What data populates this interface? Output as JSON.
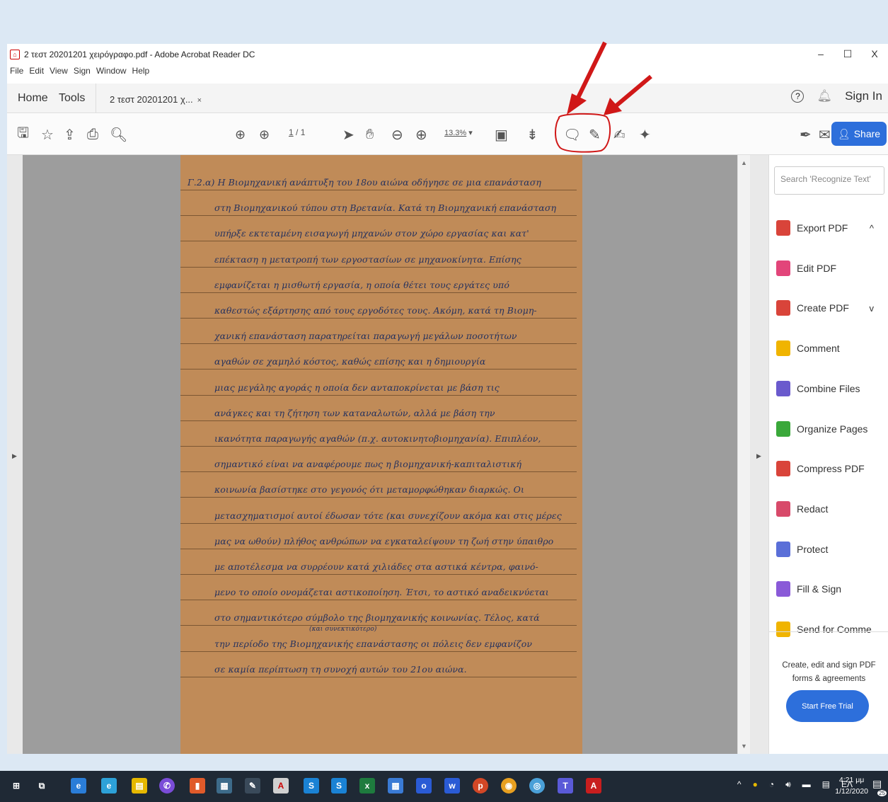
{
  "window": {
    "title": "2 τεστ 20201201 χειρόγραφο.pdf - Adobe Acrobat Reader DC",
    "controls": [
      "–",
      "☐",
      "X"
    ]
  },
  "menu": [
    "File",
    "Edit",
    "View",
    "Sign",
    "Window",
    "Help"
  ],
  "tabs": {
    "home": "Home",
    "tools": "Tools",
    "doc": "2 τεστ 20201201 χ...",
    "close": "×",
    "help": "?",
    "sign_in": "Sign In"
  },
  "toolbar": {
    "page_current": "1",
    "page_total": "/ 1",
    "zoom": "13.3%",
    "share": "Share"
  },
  "document": {
    "lines": [
      "Γ.2.α) Η Βιομηχανική ανάπτυξη του 18ου αιώνα οδήγησε σε μια επανάσταση",
      "στη Βιομηχανικού τύπου στη Βρετανία. Κατά τη Βιομηχανική επανάσταση",
      "υπήρξε εκτεταμένη εισαγωγή μηχανών στον χώρο εργασίας και κατ'",
      "επέκταση η μετατροπή των εργοστασίων σε μηχανοκίνητα. Επίσης",
      "εμφανίζεται η μισθωτή εργασία, η οποία θέτει τους εργάτες υπό",
      "καθεστώς εξάρτησης από τους εργοδότες τους. Ακόμη, κατά τη Βιομη-",
      "χανική επανάσταση παρατηρείται παραγωγή μεγάλων ποσοτήτων",
      "αγαθών σε χαμηλό κόστος, καθώς επίσης και η δημιουργία",
      "μιας μεγάλης αγοράς η οποία δεν ανταποκρίνεται με βάση τις",
      "ανάγκες και τη ζήτηση των καταναλωτών, αλλά με βάση την",
      "ικανότητα παραγωγής αγαθών (π.χ. αυτοκινητοβιομηχανία). Επιπλέον,",
      "σημαντικό είναι να αναφέρουμε πως η βιομηχανική-καπιταλιστική",
      "κοινωνία βασίστηκε στο γεγονός ότι μεταμορφώθηκαν διαρκώς. Οι",
      "μετασχηματισμοί αυτοί έδωσαν τότε (και συνεχίζουν ακόμα και στις μέρες",
      "μας να ωθούν) πλήθος ανθρώπων να εγκαταλείψουν τη ζωή στην ύπαιθρο",
      "με αποτέλεσμα να συρρέουν κατά χιλιάδες στα αστικά κέντρα, φαινό-",
      "μενο το οποίο ονομάζεται αστικοποίηση. Έτσι, το αστικό αναδεικνύεται",
      "στο σημαντικότερο σύμβολο της βιομηχανικής κοινωνίας. Τέλος, κατά",
      "την περίοδο της Βιομηχανικής επανάστασης οι πόλεις δεν εμφανίζον",
      "σε καμία περίπτωση τη συνοχή αυτών του 21ου αιώνα."
    ],
    "annotation": "(και συνεκτικότερο)"
  },
  "search": {
    "placeholder": "Search 'Recognize Text'"
  },
  "right_panel": [
    {
      "label": "Export PDF",
      "icon": "export-pdf-icon",
      "color": "#d9443a",
      "chevron": "^"
    },
    {
      "label": "Edit PDF",
      "icon": "edit-pdf-icon",
      "color": "#e2457a",
      "chevron": ""
    },
    {
      "label": "Create PDF",
      "icon": "create-pdf-icon",
      "color": "#d9443a",
      "chevron": "v"
    },
    {
      "label": "Comment",
      "icon": "comment-icon",
      "color": "#f0b400",
      "chevron": ""
    },
    {
      "label": "Combine Files",
      "icon": "combine-files-icon",
      "color": "#6a5acd",
      "chevron": ""
    },
    {
      "label": "Organize Pages",
      "icon": "organize-pages-icon",
      "color": "#3aa83a",
      "chevron": ""
    },
    {
      "label": "Compress PDF",
      "icon": "compress-pdf-icon",
      "color": "#d9443a",
      "chevron": ""
    },
    {
      "label": "Redact",
      "icon": "redact-icon",
      "color": "#d84a6a",
      "chevron": ""
    },
    {
      "label": "Protect",
      "icon": "protect-icon",
      "color": "#5a6fd8",
      "chevron": ""
    },
    {
      "label": "Fill & Sign",
      "icon": "fill-sign-icon",
      "color": "#8a5ad8",
      "chevron": ""
    },
    {
      "label": "Send for Comme",
      "icon": "send-for-comment-icon",
      "color": "#f0b400",
      "chevron": ""
    }
  ],
  "promo": {
    "text1": "Create, edit and sign PDF",
    "text2": "forms & agreements",
    "button": "Start Free Trial"
  },
  "taskbar": {
    "lang": "EΛ",
    "time": "4:21 μμ",
    "date": "1/12/2020",
    "notification_count": "25"
  },
  "colors": {
    "accent": "#2d6fdb",
    "arrow": "#d01818",
    "paper": "#c08b58"
  }
}
